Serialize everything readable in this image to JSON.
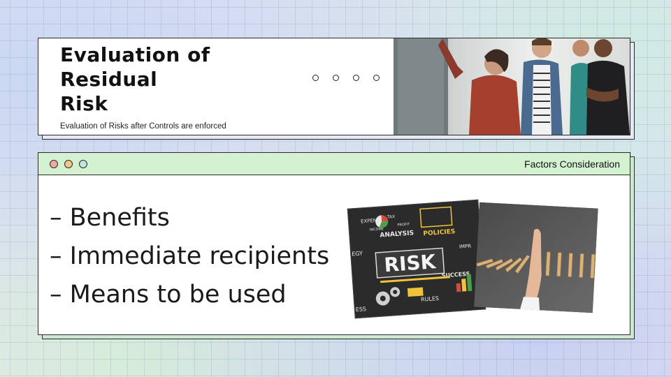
{
  "header_card": {
    "title": "Evaluation of\nResidual\nRisk",
    "subtitle": "Evaluation of Risks after Controls are enforced",
    "photo_alt": "Team looking at a board"
  },
  "content_card": {
    "header_label": "Factors Consideration",
    "window_dot_colors": [
      "#f2a7a7",
      "#f5c58a",
      "#bfe6e0"
    ],
    "bullets": [
      "– Benefits",
      "– Immediate recipients",
      "– Means to be used"
    ],
    "risk_image": {
      "center_word": "RISK",
      "labels": [
        "EXPENSES",
        "TAX",
        "ANALYSIS",
        "POLICIES",
        "PROFIT",
        "INCOME",
        "EGY",
        "IMPR",
        "SUCCESS",
        "ESS",
        "RULES"
      ]
    }
  }
}
